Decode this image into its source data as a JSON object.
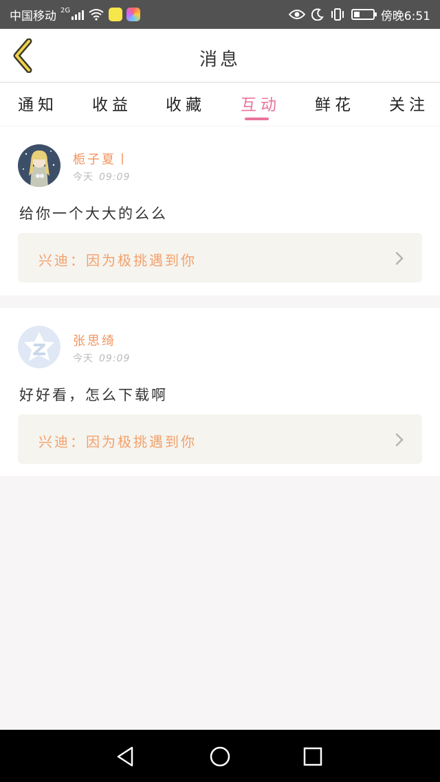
{
  "status_bar": {
    "carrier": "中国移动",
    "network": "2G",
    "time": "傍晚6:51",
    "battery_level": 0.3
  },
  "header": {
    "title": "消息",
    "back_icon": "chevron-left-icon"
  },
  "tabs": [
    {
      "label": "通知",
      "active": false
    },
    {
      "label": "收益",
      "active": false
    },
    {
      "label": "收藏",
      "active": false
    },
    {
      "label": "互动",
      "active": true
    },
    {
      "label": "鲜花",
      "active": false
    },
    {
      "label": "关注",
      "active": false
    }
  ],
  "messages": [
    {
      "user": "栀子夏丨",
      "date": "今天",
      "time": "09:09",
      "comment": "给你一个大大的么么",
      "quote": "兴迪：因为极挑遇到你"
    },
    {
      "user": "张思绮",
      "date": "今天",
      "time": "09:09",
      "comment": "好好看，怎么下载啊",
      "quote": "兴迪：因为极挑遇到你"
    }
  ],
  "colors": {
    "accent": "#e8749b",
    "username": "#f1945f",
    "quote_text": "#f3a06a",
    "quote_bg": "#f5f4ef",
    "status_bar": "#525252",
    "nav_bar": "#000000"
  }
}
